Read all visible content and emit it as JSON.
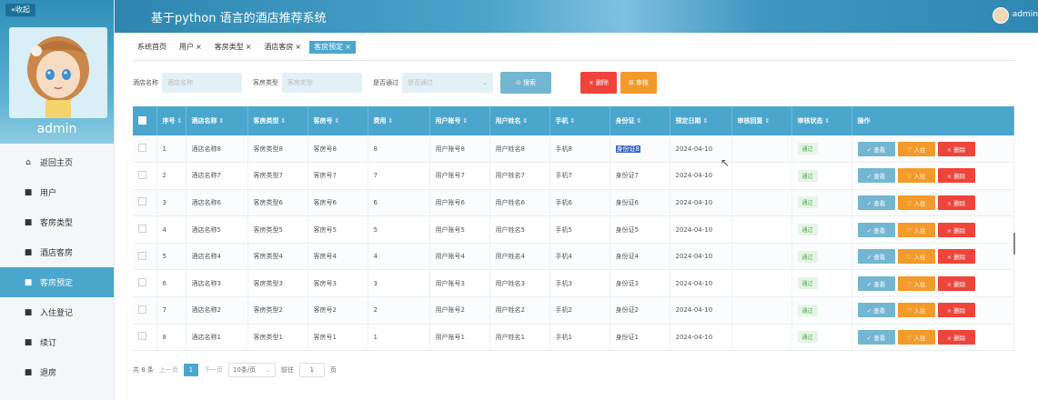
{
  "sidebar": {
    "collapse_label": "«收起",
    "admin_name": "admin",
    "items": [
      {
        "label": "返回主页",
        "icon": "home-icon",
        "glyph": "⌂",
        "active": false
      },
      {
        "label": "用户",
        "icon": "user-icon",
        "glyph": "■",
        "active": false
      },
      {
        "label": "客房类型",
        "icon": "room-type-icon",
        "glyph": "■",
        "active": false
      },
      {
        "label": "酒店客房",
        "icon": "room-icon",
        "glyph": "■",
        "active": false
      },
      {
        "label": "客房预定",
        "icon": "booking-icon",
        "glyph": "■",
        "active": true
      },
      {
        "label": "入住登记",
        "icon": "checkin-icon",
        "glyph": "■",
        "active": false
      },
      {
        "label": "续订",
        "icon": "renew-icon",
        "glyph": "■",
        "active": false
      },
      {
        "label": "退房",
        "icon": "checkout-icon",
        "glyph": "■",
        "active": false
      }
    ]
  },
  "header": {
    "title": "基于python 语言的酒店推荐系统",
    "user": "admin"
  },
  "tabs": [
    {
      "label": "系统首页",
      "closable": false,
      "active": false
    },
    {
      "label": "用户",
      "closable": true,
      "active": false
    },
    {
      "label": "客房类型",
      "closable": true,
      "active": false
    },
    {
      "label": "酒店客房",
      "closable": true,
      "active": false
    },
    {
      "label": "客房预定",
      "closable": true,
      "active": true
    }
  ],
  "filters": {
    "hotel_label": "酒店名称",
    "hotel_placeholder": "酒店名称",
    "roomtype_label": "客房类型",
    "roomtype_placeholder": "客房类型",
    "pass_label": "是否通过",
    "pass_placeholder": "是否通过",
    "search_btn": "⊙ 搜索",
    "delete_btn": "× 删除",
    "audit_btn": "⊞ 审核"
  },
  "table": {
    "headers": [
      "序号",
      "酒店名称",
      "客房类型",
      "客房号",
      "费用",
      "用户账号",
      "用户姓名",
      "手机",
      "身份证",
      "预定日期",
      "审核回复",
      "审核状态",
      "操作"
    ],
    "rows": [
      [
        "1",
        "酒店名称8",
        "客房类型8",
        "客房号8",
        "8",
        "用户账号8",
        "用户姓名8",
        "手机8",
        "身份证8",
        "2024-04-10",
        "",
        "通过"
      ],
      [
        "2",
        "酒店名称7",
        "客房类型7",
        "客房号7",
        "7",
        "用户账号7",
        "用户姓名7",
        "手机7",
        "身份证7",
        "2024-04-10",
        "",
        "通过"
      ],
      [
        "3",
        "酒店名称6",
        "客房类型6",
        "客房号6",
        "6",
        "用户账号6",
        "用户姓名6",
        "手机6",
        "身份证6",
        "2024-04-10",
        "",
        "通过"
      ],
      [
        "4",
        "酒店名称5",
        "客房类型5",
        "客房号5",
        "5",
        "用户账号5",
        "用户姓名5",
        "手机5",
        "身份证5",
        "2024-04-10",
        "",
        "通过"
      ],
      [
        "5",
        "酒店名称4",
        "客房类型4",
        "客房号4",
        "4",
        "用户账号4",
        "用户姓名4",
        "手机4",
        "身份证4",
        "2024-04-10",
        "",
        "通过"
      ],
      [
        "6",
        "酒店名称3",
        "客房类型3",
        "客房号3",
        "3",
        "用户账号3",
        "用户姓名3",
        "手机3",
        "身份证3",
        "2024-04-10",
        "",
        "通过"
      ],
      [
        "7",
        "酒店名称2",
        "客房类型2",
        "客房号2",
        "2",
        "用户账号2",
        "用户姓名2",
        "手机2",
        "身份证2",
        "2024-04-10",
        "",
        "通过"
      ],
      [
        "8",
        "酒店名称1",
        "客房类型1",
        "客房号1",
        "1",
        "用户账号1",
        "用户姓名1",
        "手机1",
        "身份证1",
        "2024-04-10",
        "",
        "通过"
      ]
    ],
    "ops": {
      "view": "✓ 查看",
      "checkin": "♡ 入住",
      "delete": "× 删除"
    }
  },
  "pagination": {
    "total": "共 8 条",
    "prev": "上一页",
    "current": "1",
    "next": "下一页",
    "page_size": "10条/页",
    "goto_label": "前往",
    "goto_value": "1",
    "page_suffix": "页"
  }
}
